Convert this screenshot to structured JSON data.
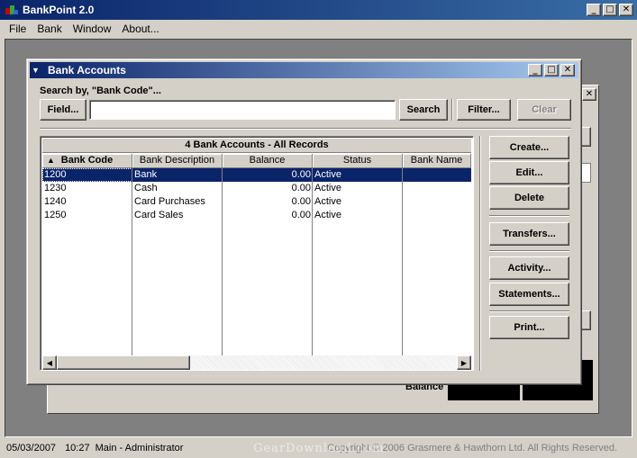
{
  "app": {
    "title": "BankPoint 2.0",
    "menu": [
      "File",
      "Bank",
      "Window",
      "About..."
    ]
  },
  "bg_window": {
    "balance_label": "Balance"
  },
  "bank_accounts": {
    "title": "Bank Accounts",
    "search_by": "Search by, \"Bank Code\"...",
    "field_label": "Field...",
    "search_value": "",
    "search_label": "Search",
    "filter_label": "Filter...",
    "clear_label": "Clear",
    "grid": {
      "caption": "4 Bank Accounts - All Records",
      "columns": [
        "Bank Code",
        "Bank Description",
        "Balance",
        "Status",
        "Bank Name"
      ],
      "rows": [
        {
          "code": "1200",
          "description": "Bank",
          "balance": "0.00",
          "status": "Active",
          "bank_name": "",
          "selected": true
        },
        {
          "code": "1230",
          "description": "Cash",
          "balance": "0.00",
          "status": "Active",
          "bank_name": ""
        },
        {
          "code": "1240",
          "description": "Card Purchases",
          "balance": "0.00",
          "status": "Active",
          "bank_name": ""
        },
        {
          "code": "1250",
          "description": "Card Sales",
          "balance": "0.00",
          "status": "Active",
          "bank_name": ""
        }
      ]
    },
    "buttons": {
      "create": "Create...",
      "edit": "Edit...",
      "delete": "Delete",
      "transfers": "Transfers...",
      "activity": "Activity...",
      "statements": "Statements...",
      "print": "Print..."
    }
  },
  "status_bar": {
    "date": "05/03/2007",
    "time": "10:27",
    "user": "Main - Administrator",
    "copyright": "Copyright © 2006 Grasmere & Hawthorn Ltd. All Rights Reserved.",
    "watermark": "GearDownload.com"
  },
  "colors": {
    "titlebar": "#0a246a",
    "selection": "#0a246a",
    "face": "#d4d0c8",
    "mdi_background": "#808080"
  }
}
